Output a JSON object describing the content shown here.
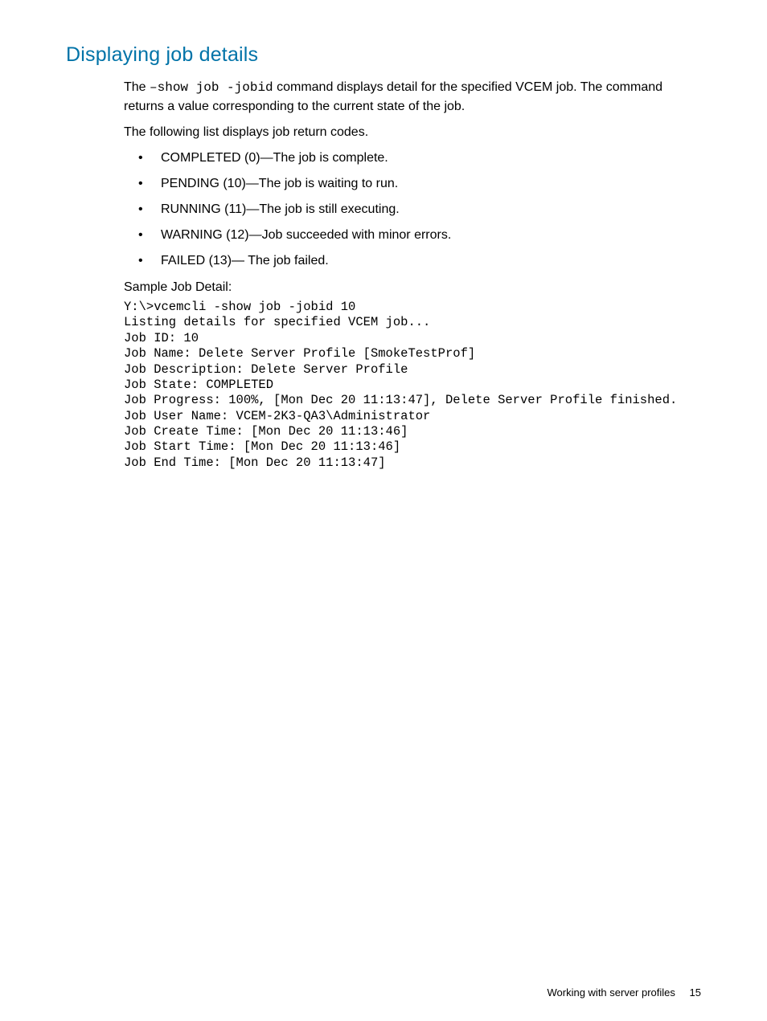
{
  "heading": "Displaying job details",
  "intro": {
    "prefix": "The ",
    "command": "–show job -jobid",
    "suffix": " command displays detail for the specified VCEM job. The command returns a value corresponding to the current state of the job."
  },
  "list_intro": "The following list displays job return codes.",
  "return_codes": [
    "COMPLETED (0)—The job is complete.",
    "PENDING (10)—The job is waiting to run.",
    "RUNNING (11)—The job is still executing.",
    "WARNING (12)—Job succeeded with minor errors.",
    "FAILED (13)— The job failed."
  ],
  "sample_label": "Sample Job Detail:",
  "sample_output": "Y:\\>vcemcli -show job -jobid 10\nListing details for specified VCEM job...\nJob ID: 10\nJob Name: Delete Server Profile [SmokeTestProf]\nJob Description: Delete Server Profile\nJob State: COMPLETED\nJob Progress: 100%, [Mon Dec 20 11:13:47], Delete Server Profile finished.\nJob User Name: VCEM-2K3-QA3\\Administrator\nJob Create Time: [Mon Dec 20 11:13:46]\nJob Start Time: [Mon Dec 20 11:13:46]\nJob End Time: [Mon Dec 20 11:13:47]",
  "footer": {
    "section": "Working with server profiles",
    "page": "15"
  }
}
